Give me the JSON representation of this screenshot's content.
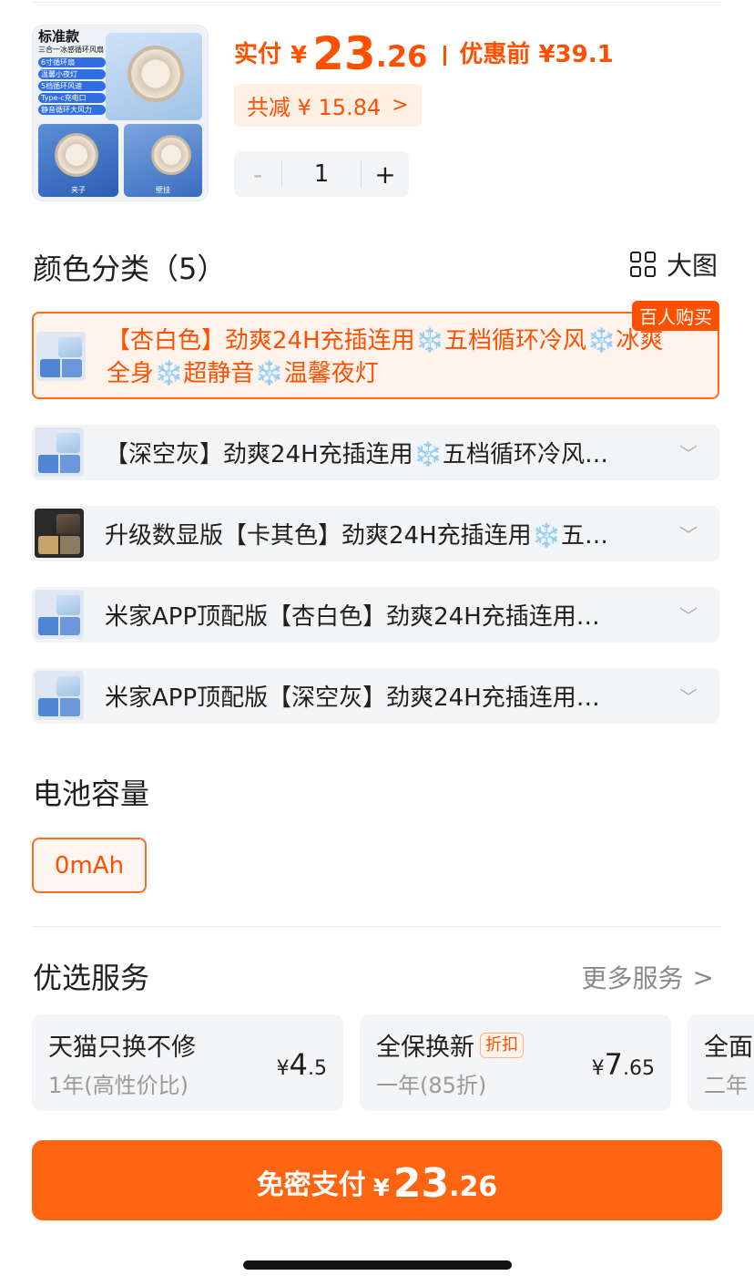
{
  "product": {
    "thumb_title": "标准款",
    "thumb_subtitle": "三合一冰感循环风扇",
    "thumb_features": [
      "6寸循环扇",
      "温馨小夜灯",
      "5档循环风速",
      "Type-c充电口",
      "静音循环大风力"
    ],
    "thumb_caption_left": "夹子",
    "thumb_caption_right": "壁挂"
  },
  "price": {
    "label": "实付",
    "currency": "¥",
    "integer": "23",
    "decimal": ".26",
    "original_label": "优惠前 ¥39.1",
    "discount_text": "共减 ¥ 15.84",
    "discount_chevron": ">"
  },
  "quantity": {
    "minus": "-",
    "value": "1",
    "plus": "+"
  },
  "color_section": {
    "title": "颜色分类（5）",
    "big_view_label": "大图",
    "big_view_icon": "grid-icon",
    "options": [
      {
        "label": "【杏白色】劲爽24H充插连用❄️五档循环冷风❄️冰爽全身❄️超静音❄️温馨夜灯",
        "badge": "百人购买",
        "selected": true
      },
      {
        "label": "【深空灰】劲爽24H充插连用❄️五档循环冷风…",
        "selected": false
      },
      {
        "label": "升级数显版【卡其色】劲爽24H充插连用❄️五…",
        "selected": false
      },
      {
        "label": "米家APP顶配版【杏白色】劲爽24H充插连用…",
        "selected": false
      },
      {
        "label": "米家APP顶配版【深空灰】劲爽24H充插连用…",
        "selected": false
      }
    ],
    "chevron": "﹀"
  },
  "battery_section": {
    "title": "电池容量",
    "options": [
      "0mAh"
    ]
  },
  "services_section": {
    "title": "优选服务",
    "more_label": "更多服务",
    "more_chevron": ">",
    "cards": [
      {
        "title": "天猫只换不修",
        "subtitle": "1年(高性价比)",
        "price_currency": "¥",
        "price_int": "4",
        "price_dec": ".5"
      },
      {
        "title": "全保换新",
        "tag": "折扣",
        "subtitle": "一年(85折)",
        "price_currency": "¥",
        "price_int": "7",
        "price_dec": ".65"
      },
      {
        "title": "全面",
        "subtitle": "二年"
      }
    ]
  },
  "pay_button": {
    "label": "免密支付",
    "currency": "¥",
    "integer": "23",
    "decimal": ".26"
  },
  "colors": {
    "accent": "#ff5000",
    "button": "#ff6410",
    "chip_bg": "#f3f4f6"
  }
}
